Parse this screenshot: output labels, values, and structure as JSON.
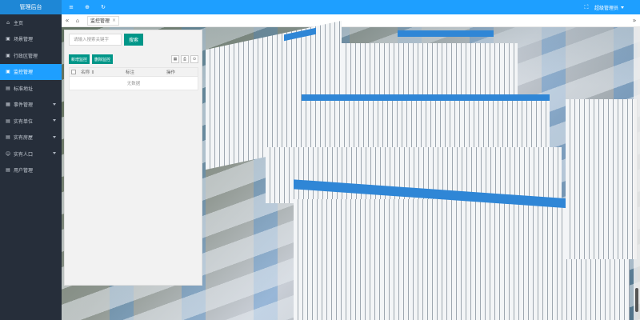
{
  "app": {
    "brand": "管理后台"
  },
  "sidebar": {
    "items": [
      {
        "label": "主页",
        "icon": "⌂",
        "has_children": false,
        "active": false
      },
      {
        "label": "场景管理",
        "icon": "▣",
        "has_children": false,
        "active": false
      },
      {
        "label": "行政区管理",
        "icon": "▣",
        "has_children": false,
        "active": false
      },
      {
        "label": "监控管理",
        "icon": "▣",
        "has_children": false,
        "active": true
      },
      {
        "label": "标准地址",
        "icon": "▤",
        "has_children": false,
        "active": false
      },
      {
        "label": "事件管理",
        "icon": "▦",
        "has_children": true,
        "active": false
      },
      {
        "label": "实有单位",
        "icon": "▤",
        "has_children": true,
        "active": false
      },
      {
        "label": "实有房屋",
        "icon": "▤",
        "has_children": true,
        "active": false
      },
      {
        "label": "实有人口",
        "icon": "☺",
        "has_children": true,
        "active": false
      },
      {
        "label": "用户管理",
        "icon": "▤",
        "has_children": false,
        "active": false
      }
    ]
  },
  "header": {
    "buttons": [
      "≡",
      "⊕",
      "↻"
    ],
    "expand_icon": "⛶",
    "user": "超级管理员"
  },
  "tabs": {
    "left_arrow": "«",
    "home_icon": "⌂",
    "active_tab": "监控管理",
    "close": "×",
    "right_arrow": "»"
  },
  "panel": {
    "search_placeholder": "请输入搜索关键字",
    "search_button": "搜索",
    "add_button": "新增监控",
    "delete_button": "删除监控",
    "icon_buttons": [
      "▦",
      "⎙",
      "⊙"
    ],
    "table": {
      "col_name": "名称",
      "col_sort": "⇕",
      "col_note": "标注",
      "col_op": "操作",
      "empty": "无数据"
    }
  },
  "colors": {
    "accent": "#1e9fff",
    "sidebar": "#262e3a",
    "primary_button": "#009688"
  }
}
